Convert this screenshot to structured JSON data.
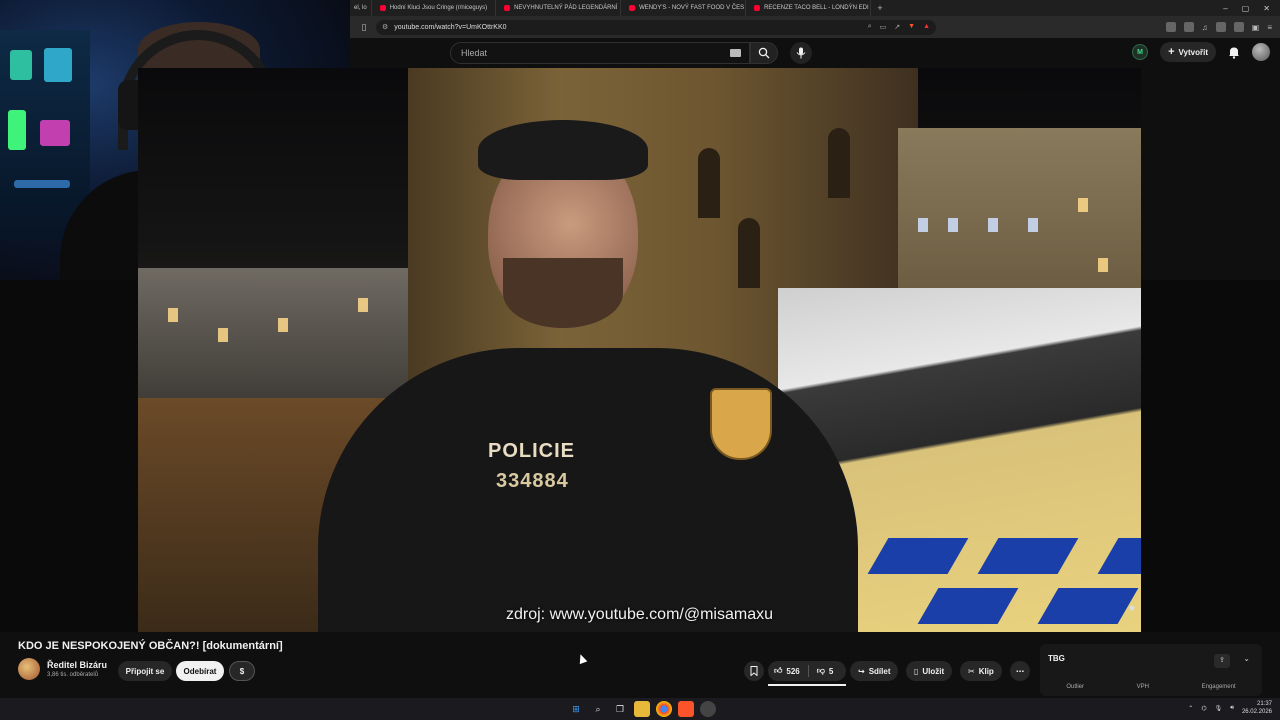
{
  "browser": {
    "tabs": [
      {
        "label": "el, lo"
      },
      {
        "label": "Hodní Kluci Jsou Cringe (r/niceguys)"
      },
      {
        "label": "NEVYHNUTELNÝ PÁD LEGENDÁRNÍ"
      },
      {
        "label": "WENDY'S - NOVÝ FAST FOOD V ČES"
      },
      {
        "label": "RECENZE TACO BELL - LONDÝN EDI"
      }
    ],
    "new_tab_symbol": "+",
    "url": "youtube.com/watch?v=UmKOttrKK0"
  },
  "youtube": {
    "search_placeholder": "Hledat",
    "create_label": "Vytvořit",
    "video": {
      "overlay_police": "POLICIE",
      "overlay_number": "334884",
      "caption": "zdroj: www.youtube.com/@misamaxu"
    },
    "title": "KDO JE NESPOKOJENÝ OBČAN?! [dokumentární]",
    "channel": {
      "name": "Ředitel Bizáru",
      "subscribers": "3,86 tis. odběratelů"
    },
    "buttons": {
      "join": "Připojit se",
      "subscribe": "Odebírat",
      "dollar": "$"
    },
    "actions": {
      "likes": "526",
      "dislikes": "5",
      "share": "Sdílet",
      "save": "Uložit",
      "clip": "Klip",
      "more": "⋯"
    },
    "panel": {
      "logo": "TBG",
      "tabs": [
        "Outlier",
        "VPH",
        "Engagement"
      ]
    }
  },
  "taskbar": {
    "time": "21:37",
    "date": "26.02.2026"
  },
  "colors": {
    "accent_red": "#ff0033",
    "police_blue": "#1b3fa8",
    "background": "#0f0f0f"
  }
}
